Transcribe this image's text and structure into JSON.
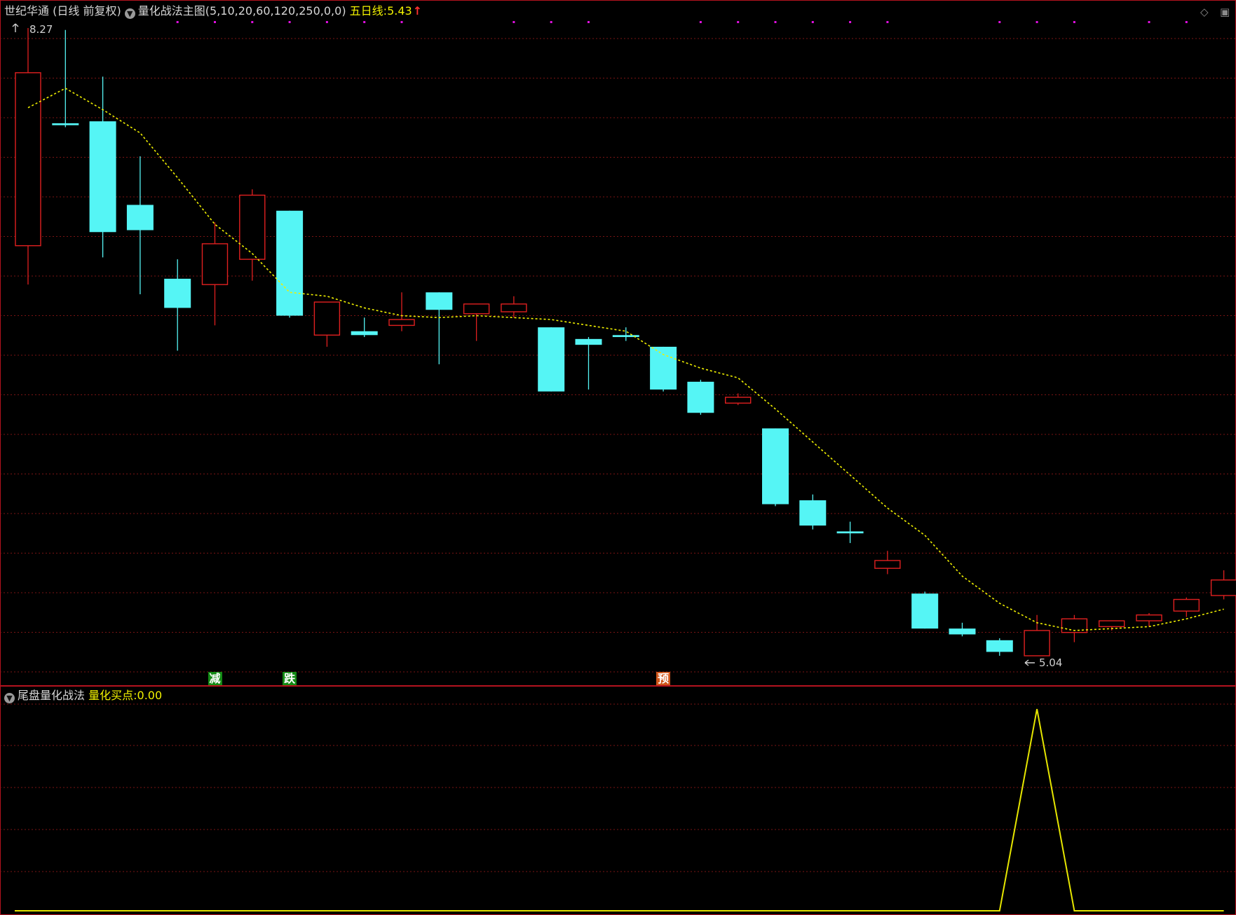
{
  "header": {
    "stock_name": "世纪华通",
    "period": "(日线 前复权)",
    "indicator": "量化战法主图(5,10,20,60,120,250,0,0)",
    "ma_label": "五日线:",
    "ma_value": "5.43"
  },
  "marks": {
    "high": "8.27",
    "low": "5.04"
  },
  "signals": [
    {
      "text": "减",
      "bg": "#138a14",
      "fg": "#ffffff",
      "index": 5
    },
    {
      "text": "跌",
      "bg": "#138a14",
      "fg": "#ffffff",
      "index": 7
    },
    {
      "text": "预",
      "bg": "#d0561a",
      "fg": "#ffffff",
      "index": 17
    }
  ],
  "subpanel": {
    "name": "尾盘量化战法",
    "label": "量化买点:",
    "value": "0.00"
  },
  "icons": {
    "settings": "chevron-down-circle-icon",
    "corner_left": "diamond-icon",
    "corner_right": "window-icon"
  },
  "colors": {
    "up": "#e02020",
    "down": "#55f5f5",
    "ma": "#f0f000",
    "grid": "#7a1414",
    "dot": "#e010e0",
    "border": "#b4131f"
  },
  "chart_data": {
    "type": "candlestick",
    "candles": [
      {
        "open": 7.15,
        "high": 8.27,
        "low": 6.95,
        "close": 8.04
      },
      {
        "open": 7.78,
        "high": 8.26,
        "low": 7.76,
        "close": 7.77
      },
      {
        "open": 7.79,
        "high": 8.02,
        "low": 7.09,
        "close": 7.22
      },
      {
        "open": 7.36,
        "high": 7.61,
        "low": 6.9,
        "close": 7.23
      },
      {
        "open": 6.98,
        "high": 7.08,
        "low": 6.61,
        "close": 6.83
      },
      {
        "open": 6.95,
        "high": 7.27,
        "low": 6.74,
        "close": 7.16
      },
      {
        "open": 7.08,
        "high": 7.44,
        "low": 6.97,
        "close": 7.41
      },
      {
        "open": 7.33,
        "high": 7.33,
        "low": 6.78,
        "close": 6.79
      },
      {
        "open": 6.69,
        "high": 6.81,
        "low": 6.63,
        "close": 6.86
      },
      {
        "open": 6.71,
        "high": 6.78,
        "low": 6.68,
        "close": 6.69
      },
      {
        "open": 6.74,
        "high": 6.91,
        "low": 6.71,
        "close": 6.77
      },
      {
        "open": 6.91,
        "high": 6.84,
        "low": 6.54,
        "close": 6.82
      },
      {
        "open": 6.8,
        "high": 6.84,
        "low": 6.66,
        "close": 6.85
      },
      {
        "open": 6.81,
        "high": 6.89,
        "low": 6.78,
        "close": 6.85
      },
      {
        "open": 6.73,
        "high": 6.39,
        "low": 6.47,
        "close": 6.4
      },
      {
        "open": 6.67,
        "high": 6.68,
        "low": 6.41,
        "close": 6.64
      },
      {
        "open": 6.69,
        "high": 6.73,
        "low": 6.66,
        "close": 6.68
      },
      {
        "open": 6.63,
        "high": 6.63,
        "low": 6.4,
        "close": 6.41
      },
      {
        "open": 6.45,
        "high": 6.46,
        "low": 6.28,
        "close": 6.29
      },
      {
        "open": 6.34,
        "high": 6.39,
        "low": 6.33,
        "close": 6.37
      },
      {
        "open": 6.21,
        "high": 6.21,
        "low": 5.81,
        "close": 5.82
      },
      {
        "open": 5.84,
        "high": 5.87,
        "low": 5.69,
        "close": 5.71
      },
      {
        "open": 5.68,
        "high": 5.73,
        "low": 5.62,
        "close": 5.67
      },
      {
        "open": 5.49,
        "high": 5.58,
        "low": 5.46,
        "close": 5.53
      },
      {
        "open": 5.36,
        "high": 5.37,
        "low": 5.18,
        "close": 5.18
      },
      {
        "open": 5.18,
        "high": 5.21,
        "low": 5.14,
        "close": 5.15
      },
      {
        "open": 5.12,
        "high": 5.13,
        "low": 5.04,
        "close": 5.06
      },
      {
        "open": 5.04,
        "high": 5.25,
        "low": 5.05,
        "close": 5.17
      },
      {
        "open": 5.16,
        "high": 5.25,
        "low": 5.11,
        "close": 5.23
      },
      {
        "open": 5.19,
        "high": 5.21,
        "low": 5.17,
        "close": 5.22
      },
      {
        "open": 5.22,
        "high": 5.26,
        "low": 5.19,
        "close": 5.25
      },
      {
        "open": 5.27,
        "high": 5.34,
        "low": 5.24,
        "close": 5.33
      },
      {
        "open": 5.35,
        "high": 5.48,
        "low": 5.33,
        "close": 5.43
      }
    ],
    "ma5": [
      7.86,
      7.96,
      7.85,
      7.73,
      7.5,
      7.26,
      7.11,
      6.91,
      6.89,
      6.83,
      6.79,
      6.78,
      6.79,
      6.78,
      6.77,
      6.74,
      6.71,
      6.59,
      6.52,
      6.47,
      6.31,
      6.14,
      5.97,
      5.8,
      5.66,
      5.45,
      5.31,
      5.21,
      5.17,
      5.18,
      5.19,
      5.23,
      5.28
    ],
    "subpanel_series": [
      0,
      0,
      0,
      0,
      0,
      0,
      0,
      0,
      0,
      0,
      0,
      0,
      0,
      0,
      0,
      0,
      0,
      0,
      0,
      0,
      0,
      0,
      0,
      0,
      0,
      0,
      0,
      1,
      0,
      0,
      0,
      0,
      0
    ],
    "top_dot_indices": [
      4,
      5,
      6,
      7,
      8,
      9,
      10,
      13,
      14,
      15,
      18,
      19,
      20,
      21,
      22,
      23,
      26,
      27,
      28,
      30,
      31
    ]
  }
}
